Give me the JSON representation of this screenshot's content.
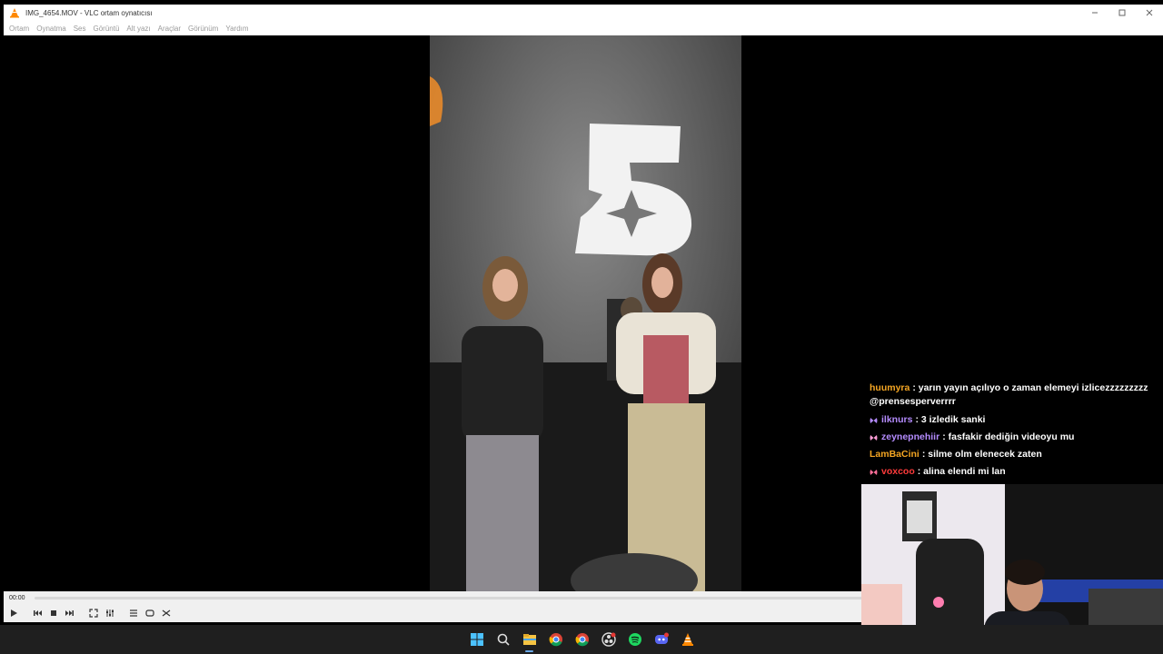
{
  "window": {
    "title": "IMG_4654.MOV - VLC ortam oynatıcısı",
    "controls": [
      "minimize-icon",
      "maximize-icon",
      "close-icon"
    ]
  },
  "menu": [
    "Ortam",
    "Oynatma",
    "Ses",
    "Görüntü",
    "Alt yazı",
    "Araçlar",
    "Görünüm",
    "Yardım"
  ],
  "player": {
    "elapsed": "00:00",
    "progress": 0,
    "buttons": [
      "play-icon",
      "previous-icon",
      "stop-icon",
      "next-icon",
      "fullscreen-icon",
      "extended-settings-icon",
      "playlist-icon",
      "loop-icon",
      "shuffle-icon"
    ]
  },
  "chat": [
    {
      "user": "huumyra",
      "color": "#f5a623",
      "badge": "",
      "text": ": yarın yayın açılıyo o zaman elemeyi izlicezzzzzzzzz @prensesperverrrr"
    },
    {
      "user": "ilknurs",
      "color": "#b58cff",
      "badge": "#b58cff",
      "text": ": 3 izledik sanki"
    },
    {
      "user": "zeynepnehiir",
      "color": "#b58cff",
      "badge": "#ff9ed8",
      "text": ": fasfakir dediğin videoyu mu"
    },
    {
      "user": "LamBaCini",
      "color": "#f5a623",
      "badge": "",
      "text": ": silme olm elenecek zaten"
    },
    {
      "user": "voxcoo",
      "color": "#ff3b3b",
      "badge": "#ff6f9a",
      "text": ": alina elendi mi lan"
    }
  ],
  "taskbar": [
    "windows-start-icon",
    "search-icon",
    "file-explorer-icon",
    "chrome-icon",
    "chrome-profile-icon",
    "obs-icon",
    "spotify-icon",
    "discord-icon",
    "vlc-icon"
  ],
  "colors": {
    "vlc_orange": "#ff8800",
    "taskbar_bg": "#1f1f1f"
  }
}
